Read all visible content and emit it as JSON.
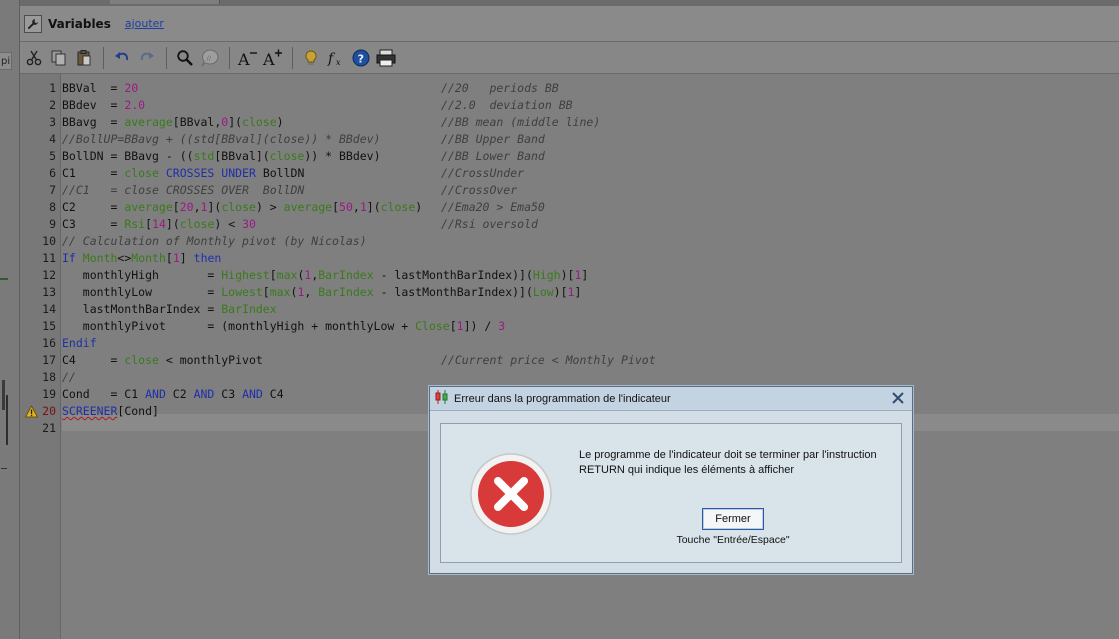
{
  "left_tab_fragment": "pi",
  "editor": {
    "title": "Variables",
    "add_link": "ajouter",
    "toolbar": [
      {
        "name": "cut-icon"
      },
      {
        "name": "copy-icon"
      },
      {
        "name": "paste-icon"
      },
      {
        "name": "undo-icon"
      },
      {
        "name": "redo-icon"
      },
      {
        "name": "search-icon"
      },
      {
        "name": "comment-icon"
      },
      {
        "name": "font-decrease-icon"
      },
      {
        "name": "font-increase-icon"
      },
      {
        "name": "lightbulb-icon"
      },
      {
        "name": "function-icon"
      },
      {
        "name": "help-icon"
      },
      {
        "name": "print-icon"
      }
    ],
    "lines": [
      {
        "n": "1",
        "code": "BBVal  = 20",
        "comment": "//20   periods BB"
      },
      {
        "n": "2",
        "code": "BBdev  = 2.0",
        "comment": "//2.0  deviation BB"
      },
      {
        "n": "3",
        "code": "BBavg  = average[BBval,0](close)",
        "comment": "//BB mean (middle line)"
      },
      {
        "n": "4",
        "code": "//BollUP=BBavg + ((std[BBval](close)) * BBdev)",
        "comment": "//BB Upper Band"
      },
      {
        "n": "5",
        "code": "BollDN = BBavg - ((std[BBval](close)) * BBdev)",
        "comment": "//BB Lower Band"
      },
      {
        "n": "6",
        "code": "C1     = close CROSSES UNDER BollDN",
        "comment": "//CrossUnder"
      },
      {
        "n": "7",
        "code": "//C1   = close CROSSES OVER  BollDN",
        "comment": "//CrossOver"
      },
      {
        "n": "8",
        "code": "C2     = average[20,1](close) > average[50,1](close)",
        "comment": "//Ema20 > Ema50"
      },
      {
        "n": "9",
        "code": "C3     = Rsi[14](close) < 30",
        "comment": "//Rsi oversold"
      },
      {
        "n": "10",
        "code": "// Calculation of Monthly pivot (by Nicolas)",
        "comment": ""
      },
      {
        "n": "11",
        "code": "If Month<>Month[1] then",
        "comment": ""
      },
      {
        "n": "12",
        "code": "   monthlyHigh       = Highest[max(1,BarIndex - lastMonthBarIndex)](High)[1]",
        "comment": ""
      },
      {
        "n": "13",
        "code": "   monthlyLow        = Lowest[max(1, BarIndex - lastMonthBarIndex)](Low)[1]",
        "comment": ""
      },
      {
        "n": "14",
        "code": "   lastMonthBarIndex = BarIndex",
        "comment": ""
      },
      {
        "n": "15",
        "code": "   monthlyPivot      = (monthlyHigh + monthlyLow + Close[1]) / 3",
        "comment": ""
      },
      {
        "n": "16",
        "code": "Endif",
        "comment": ""
      },
      {
        "n": "17",
        "code": "C4     = close < monthlyPivot",
        "comment": "//Current price < Monthly Pivot"
      },
      {
        "n": "18",
        "code": "//",
        "comment": ""
      },
      {
        "n": "19",
        "code": "Cond   = C1 AND C2 AND C3 AND C4",
        "comment": ""
      },
      {
        "n": "20",
        "code": "SCREENER[Cond]",
        "comment": ""
      },
      {
        "n": "21",
        "code": "",
        "comment": ""
      }
    ]
  },
  "dialog": {
    "title": "Erreur dans la programmation de l'indicateur",
    "message_line1": "Le programme de l'indicateur doit se terminer par l'instruction",
    "message_line2": "RETURN qui indique les éléments à afficher",
    "button_label": "Fermer",
    "hint": "Touche \"Entrée/Espace\""
  },
  "colors": {
    "keyword": "#1f2fa8",
    "function": "#3a7a1c",
    "number": "#9a1a87",
    "comment": "#3f3f3f",
    "error_red": "#d62f2f",
    "dialog_bg": "#d3dde5"
  }
}
